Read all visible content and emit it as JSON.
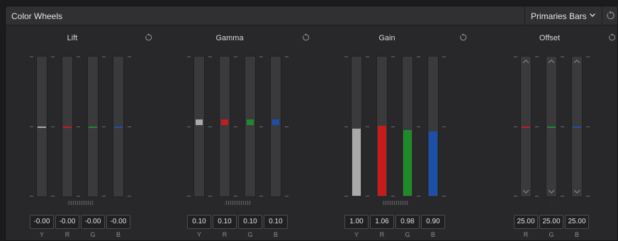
{
  "header": {
    "title": "Color Wheels",
    "mode": "Primaries Bars"
  },
  "colors": {
    "luma": "#a9a9a9",
    "red": "#c41c1c",
    "green": "#1f8a2a",
    "blue": "#1c4fa8",
    "bar_track": "#3a3a3d"
  },
  "wheels": [
    {
      "id": "lift",
      "title": "Lift",
      "type": "level",
      "channels": [
        "Y",
        "R",
        "G",
        "B"
      ],
      "values": [
        "-0.00",
        "-0.00",
        "-0.00",
        "-0.00"
      ],
      "levels": [
        0.5,
        0.5,
        0.5,
        0.5
      ],
      "style": "line"
    },
    {
      "id": "gamma",
      "title": "Gamma",
      "type": "level",
      "channels": [
        "Y",
        "R",
        "G",
        "B"
      ],
      "values": [
        "0.10",
        "0.10",
        "0.10",
        "0.10"
      ],
      "levels": [
        0.53,
        0.53,
        0.53,
        0.53
      ],
      "style": "marker"
    },
    {
      "id": "gain",
      "title": "Gain",
      "type": "fill",
      "channels": [
        "Y",
        "R",
        "G",
        "B"
      ],
      "values": [
        "1.00",
        "1.06",
        "0.98",
        "0.90"
      ],
      "levels": [
        0.48,
        0.5,
        0.47,
        0.46
      ],
      "style": "fill"
    },
    {
      "id": "offset",
      "title": "Offset",
      "type": "level",
      "channels": [
        "R",
        "G",
        "B"
      ],
      "values": [
        "25.00",
        "25.00",
        "25.00"
      ],
      "levels": [
        0.5,
        0.5,
        0.5
      ],
      "style": "offset"
    }
  ]
}
